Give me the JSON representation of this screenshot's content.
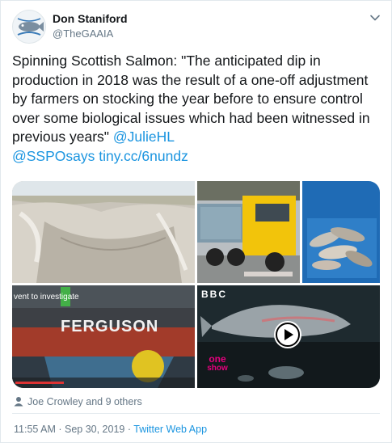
{
  "author": {
    "name": "Don Staniford",
    "handle": "@TheGAAIA"
  },
  "tweet": {
    "text_main": "Spinning Scottish Salmon: \"The anticipated dip in production in 2018 was the result of a one-off adjustment by farmers on stocking the year before to ensure control over some biological issues which had been witnessed in previous years\"",
    "mention1": "@JulieHL",
    "mention2": "@SSPOsays",
    "link": "tiny.cc/6nundz"
  },
  "media": {
    "ship_caption": "vent to investigate",
    "ship_name": "FERGUSON",
    "bbc_logo": "BBC",
    "show_logo_line1": "one",
    "show_logo_line2": "show"
  },
  "likes_text": "Joe Crowley and 9 others",
  "meta": {
    "time": "11:55 AM · Sep 30, 2019 · ",
    "source": "Twitter Web App"
  },
  "colors": {
    "link": "#1b95e0",
    "secondary": "#657786"
  }
}
